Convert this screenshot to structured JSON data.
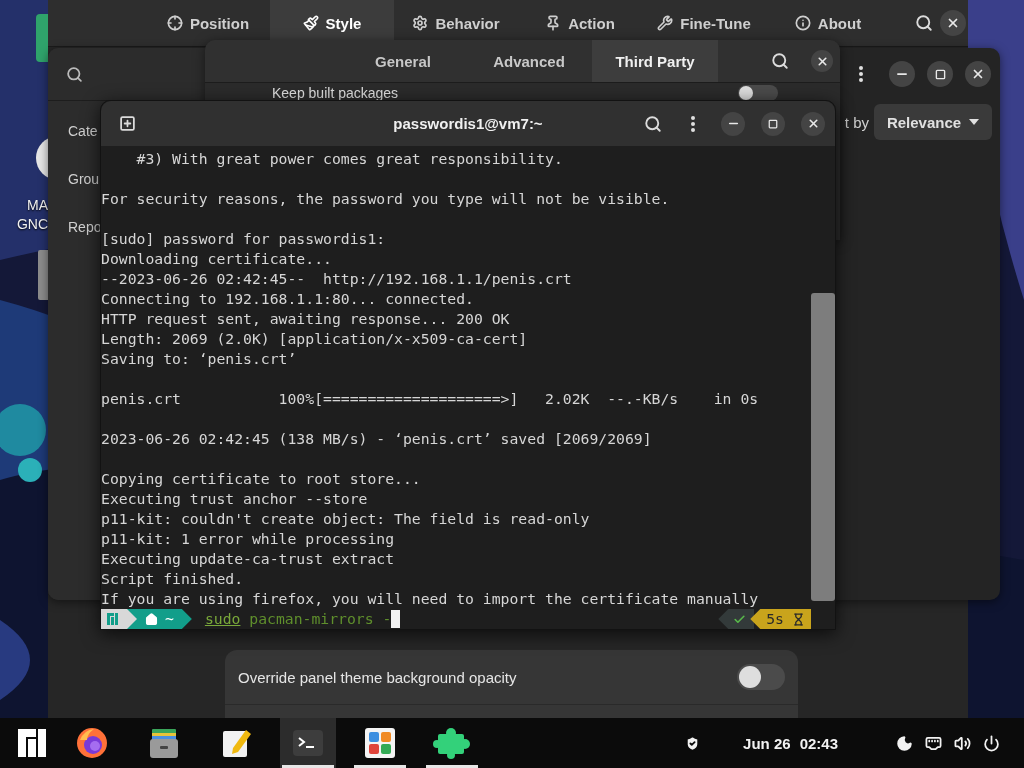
{
  "desktop": {
    "icon_label_lines": [
      "MA",
      "GNC"
    ]
  },
  "panel_settings": {
    "tabs": [
      {
        "label": "Position",
        "selected": false
      },
      {
        "label": "Style",
        "selected": true
      },
      {
        "label": "Behavior",
        "selected": false
      },
      {
        "label": "Action",
        "selected": false
      },
      {
        "label": "Fine-Tune",
        "selected": false
      },
      {
        "label": "About",
        "selected": false
      }
    ],
    "options": [
      {
        "label": "Override panel theme background opacity",
        "on": false
      }
    ]
  },
  "software_window": {
    "sidebar_items": [
      "Cate",
      "Grou",
      "Repo"
    ],
    "sort": {
      "label": "t by",
      "value": "Relevance"
    }
  },
  "preferences_dialog": {
    "tabs": [
      {
        "label": "General",
        "selected": false
      },
      {
        "label": "Advanced",
        "selected": false
      },
      {
        "label": "Third Party",
        "selected": true
      }
    ],
    "options": [
      {
        "label": "Keep built packages",
        "on": false
      }
    ]
  },
  "terminal": {
    "title": "passwordis1@vm7:~",
    "blocks": [
      [
        "    #3) With great power comes great responsibility."
      ],
      [
        "For security reasons, the password you type will not be visible."
      ],
      [
        "[sudo] password for passwordis1:",
        "Downloading certificate...",
        "--2023-06-26 02:42:45--  http://192.168.1.1/penis.crt",
        "Connecting to 192.168.1.1:80... connected.",
        "HTTP request sent, awaiting response... 200 OK",
        "Length: 2069 (2.0K) [application/x-x509-ca-cert]",
        "Saving to: ‘penis.crt’"
      ],
      [
        "penis.crt           100%[====================>]   2.02K  --.-KB/s    in 0s"
      ],
      [
        "2023-06-26 02:42:45 (138 MB/s) - ‘penis.crt’ saved [2069/2069]"
      ],
      [
        "Copying certificate to root store...",
        "Executing trust anchor --store",
        "p11-kit: couldn't create object: The field is read-only",
        "p11-kit: 1 error while processing",
        "Executing update-ca-trust extract",
        "Script finished.",
        "If you are using firefox, you will need to import the certificate manually"
      ]
    ],
    "prompt": {
      "directory": "~",
      "command": [
        {
          "text": "sudo",
          "kind": "command"
        },
        {
          "text": " pacman-mirrors -",
          "kind": "args"
        }
      ]
    },
    "status": {
      "ok": true,
      "duration": "5s"
    }
  },
  "taskbar": {
    "apps": [
      {
        "kind": "menu",
        "selected": false,
        "running": false
      },
      {
        "kind": "firefox",
        "selected": false,
        "running": false
      },
      {
        "kind": "files",
        "selected": false,
        "running": false
      },
      {
        "kind": "editor",
        "selected": false,
        "running": false
      },
      {
        "kind": "terminal",
        "selected": true,
        "running": true
      },
      {
        "kind": "software",
        "selected": false,
        "running": true
      },
      {
        "kind": "extensions",
        "selected": false,
        "running": true
      }
    ],
    "clock": {
      "date": "Jun 26",
      "time": "02:43"
    }
  }
}
